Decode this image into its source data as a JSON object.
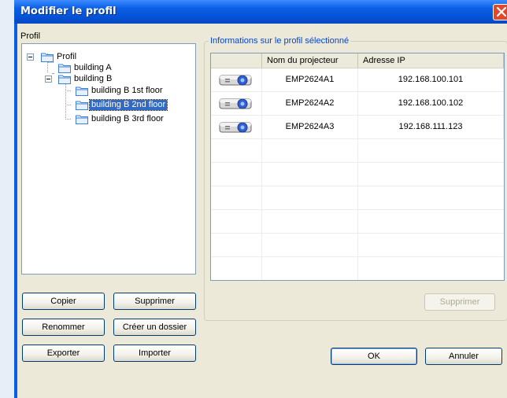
{
  "window": {
    "title": "Modifier le profil"
  },
  "profile_panel": {
    "label": "Profil",
    "tree": [
      {
        "label": "Profil",
        "selected": false
      },
      {
        "label": "building A",
        "selected": false
      },
      {
        "label": "building B",
        "selected": false
      },
      {
        "label": "building B 1st floor",
        "selected": false
      },
      {
        "label": "building B 2nd floor",
        "selected": true
      },
      {
        "label": "building B 3rd floor",
        "selected": false
      }
    ],
    "buttons": {
      "copy": "Copier",
      "delete": "Supprimer",
      "rename": "Renommer",
      "new_folder": "Créer un dossier",
      "export": "Exporter",
      "import": "Importer"
    }
  },
  "info_panel": {
    "label": "Informations sur le profil sélectionné",
    "columns": [
      "",
      "Nom du projecteur",
      "Adresse IP"
    ],
    "rows": [
      {
        "icon": "projector-icon",
        "name": "EMP2624A1",
        "ip": "192.168.100.101"
      },
      {
        "icon": "projector-icon",
        "name": "EMP2624A2",
        "ip": "192.168.100.102"
      },
      {
        "icon": "projector-icon",
        "name": "EMP2624A3",
        "ip": "192.168.111.123"
      }
    ],
    "delete_button": "Supprimer"
  },
  "dialog_buttons": {
    "ok": "OK",
    "cancel": "Annuler"
  },
  "colors": {
    "titlebar": "#0553d8",
    "selection": "#316ac5",
    "group_label": "#0046d5"
  }
}
